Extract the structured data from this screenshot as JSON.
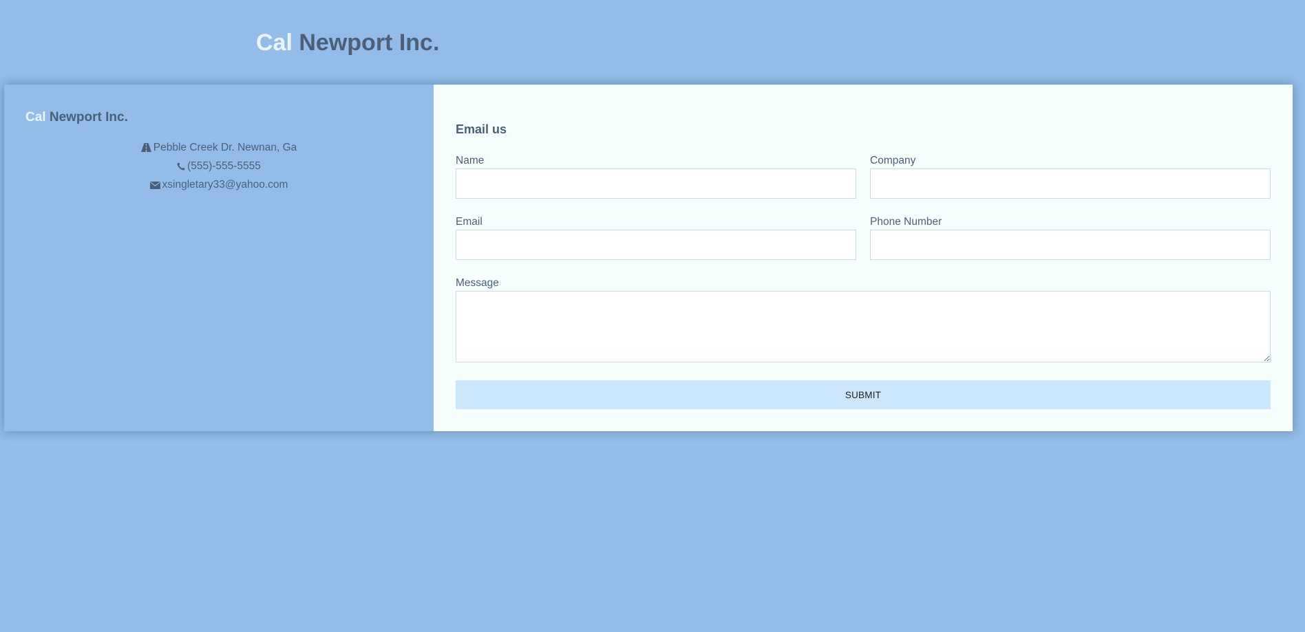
{
  "header": {
    "brand_first": "Cal",
    "brand_rest": "Newport Inc."
  },
  "info": {
    "brand_first": "Cal",
    "brand_rest": "Newport Inc.",
    "address": "Pebble Creek Dr. Newnan, Ga",
    "address_icon": "road-icon",
    "phone": "(555)-555-5555",
    "phone_icon": "phone-icon",
    "email": "xsingletary33@yahoo.com",
    "email_icon": "envelope-icon"
  },
  "form": {
    "heading": "Email us",
    "name_label": "Name",
    "name_value": "",
    "company_label": "Company",
    "company_value": "",
    "email_label": "Email",
    "email_value": "",
    "phone_label": "Phone Number",
    "phone_value": "",
    "message_label": "Message",
    "message_value": "",
    "submit_label": "SUBMIT"
  },
  "colors": {
    "background": "#93bde8",
    "brand_light": "#eaf4fb",
    "brand_dark": "#4c5f78",
    "form_background": "#f7fefe",
    "submit_background": "#cce6fb"
  }
}
